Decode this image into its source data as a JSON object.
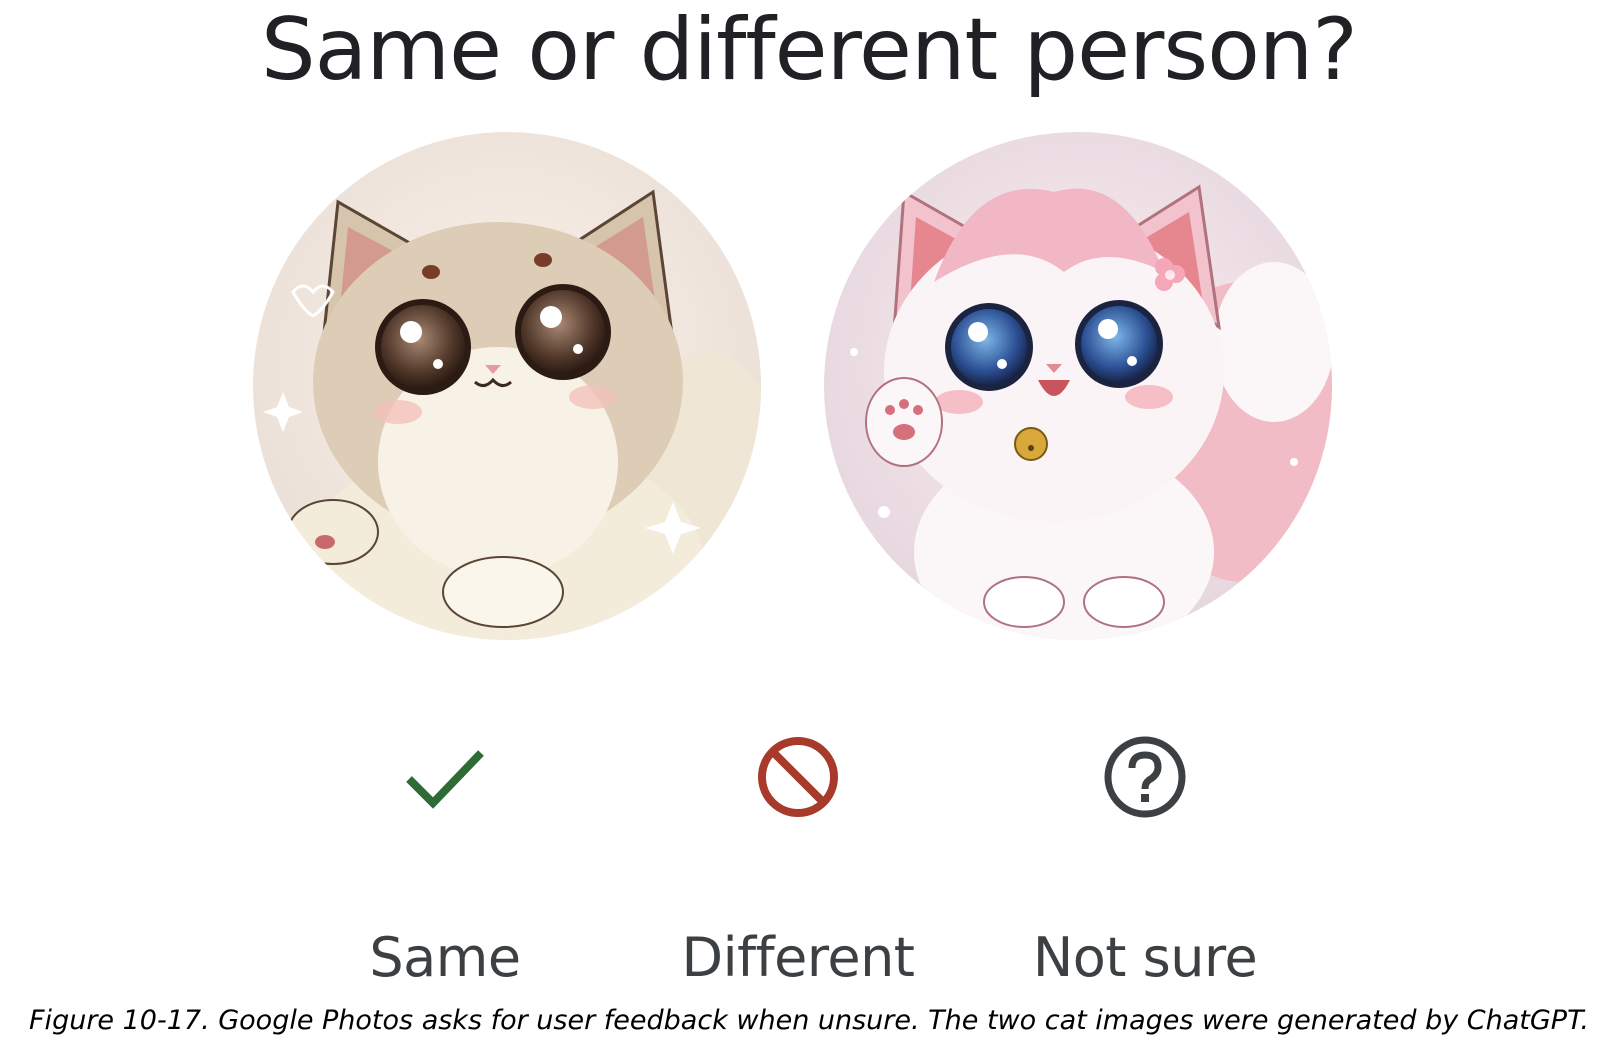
{
  "prompt": {
    "title": "Same or different person?"
  },
  "photos": [
    {
      "icon": "beige-kitten-illustration"
    },
    {
      "icon": "pink-kitten-illustration"
    }
  ],
  "choices": [
    {
      "label": "Same",
      "icon": "check-icon",
      "color": "#2e6b35"
    },
    {
      "label": "Different",
      "icon": "prohibited-icon",
      "color": "#a83a2c"
    },
    {
      "label": "Not sure",
      "icon": "help-circle-icon",
      "color": "#3c4043"
    }
  ],
  "caption": "Figure 10-17. Google Photos asks for user feedback when unsure. The two cat images were generated by ChatGPT."
}
